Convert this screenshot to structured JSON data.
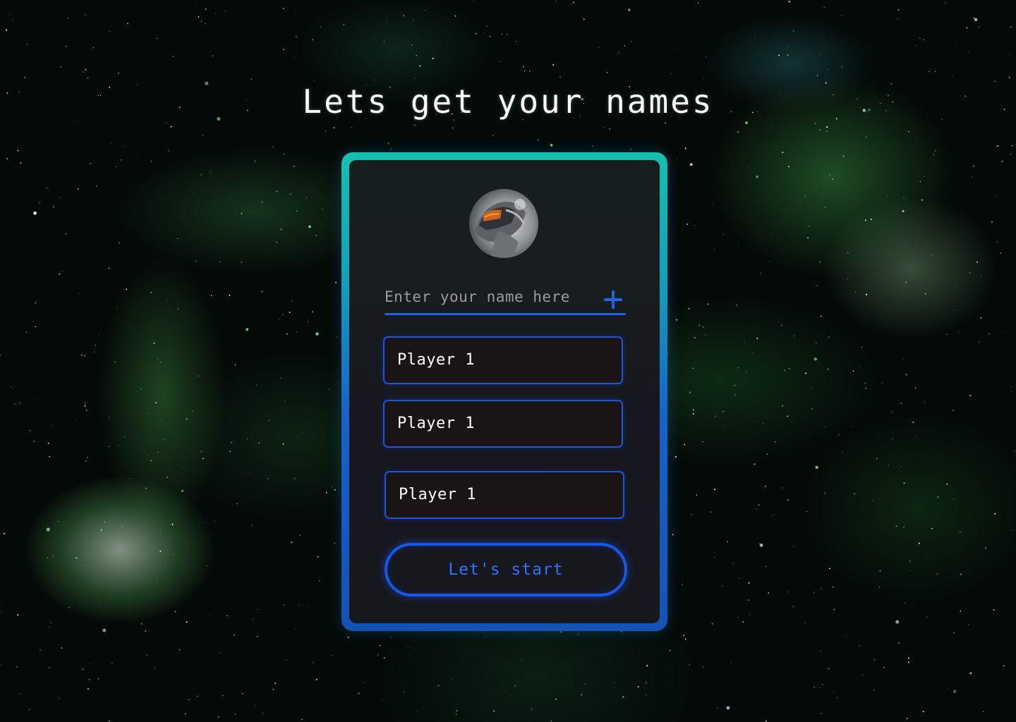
{
  "page": {
    "title": "Lets get your names"
  },
  "card": {
    "avatar_icon": "helmet-astronaut-avatar",
    "name_input": {
      "placeholder": "Enter your name here",
      "value": ""
    },
    "add_icon": "plus-icon",
    "players": [
      {
        "label": "Player 1"
      },
      {
        "label": "Player 1"
      },
      {
        "label": "Player 1"
      }
    ],
    "start_button": {
      "label": "Let's start"
    }
  },
  "colors": {
    "frame_top": "#16bfb0",
    "frame_bottom": "#1552b6",
    "accent_blue": "#1f63e6",
    "button_text": "#2a74ff",
    "card_background": "#181212",
    "text": "#ffffff"
  }
}
